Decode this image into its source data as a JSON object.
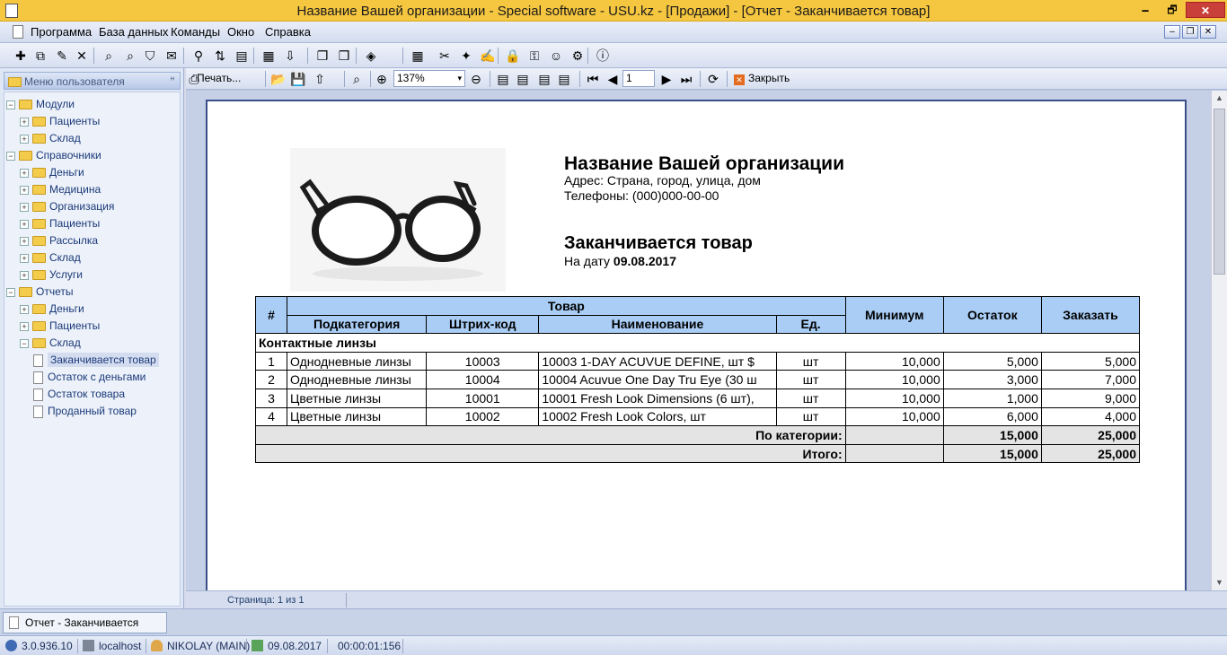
{
  "window": {
    "title": "Название Вашей организации - Special software - USU.kz - [Продажи] - [Отчет - Заканчивается товар]",
    "min_glyph": "🗕",
    "max_glyph": "🗗",
    "close_glyph": "✕"
  },
  "menu": {
    "items": [
      "Программа",
      "База данных",
      "Команды",
      "Окно",
      "Справка"
    ],
    "mdi": [
      "–",
      "❐",
      "✕"
    ]
  },
  "left_panel": {
    "header": "Меню пользователя",
    "pin": "ᵸ",
    "tree": [
      {
        "label": "Модули",
        "level": 0,
        "exp": "−",
        "kind": "folder"
      },
      {
        "label": "Пациенты",
        "level": 1,
        "exp": "+",
        "kind": "folder"
      },
      {
        "label": "Склад",
        "level": 1,
        "exp": "+",
        "kind": "folder"
      },
      {
        "label": "Справочники",
        "level": 0,
        "exp": "−",
        "kind": "folder"
      },
      {
        "label": "Деньги",
        "level": 1,
        "exp": "+",
        "kind": "folder"
      },
      {
        "label": "Медицина",
        "level": 1,
        "exp": "+",
        "kind": "folder"
      },
      {
        "label": "Организация",
        "level": 1,
        "exp": "+",
        "kind": "folder"
      },
      {
        "label": "Пациенты",
        "level": 1,
        "exp": "+",
        "kind": "folder"
      },
      {
        "label": "Рассылка",
        "level": 1,
        "exp": "+",
        "kind": "folder"
      },
      {
        "label": "Склад",
        "level": 1,
        "exp": "+",
        "kind": "folder"
      },
      {
        "label": "Услуги",
        "level": 1,
        "exp": "+",
        "kind": "folder"
      },
      {
        "label": "Отчеты",
        "level": 0,
        "exp": "−",
        "kind": "folder"
      },
      {
        "label": "Деньги",
        "level": 1,
        "exp": "+",
        "kind": "folder"
      },
      {
        "label": "Пациенты",
        "level": 1,
        "exp": "+",
        "kind": "folder"
      },
      {
        "label": "Склад",
        "level": 1,
        "exp": "−",
        "kind": "folder"
      },
      {
        "label": "Заканчивается товар",
        "level": 2,
        "exp": "",
        "kind": "doc",
        "selected": true
      },
      {
        "label": "Остаток с деньгами",
        "level": 2,
        "exp": "",
        "kind": "doc"
      },
      {
        "label": "Остаток товара",
        "level": 2,
        "exp": "",
        "kind": "doc"
      },
      {
        "label": "Проданный товар",
        "level": 2,
        "exp": "",
        "kind": "doc"
      }
    ]
  },
  "report_toolbar": {
    "print_label": "Печать...",
    "zoom": "137%",
    "page": "1",
    "close_label": "Закрыть"
  },
  "report": {
    "org_name": "Название Вашей организации",
    "address": "Адрес: Страна, город, улица, дом",
    "phones": "Телефоны: (000)000-00-00",
    "title": "Заканчивается товар",
    "date_prefix": "На дату",
    "date": "09.08.2017",
    "headers": {
      "num": "#",
      "product": "Товар",
      "subcategory": "Подкатегория",
      "barcode": "Штрих-код",
      "name": "Наименование",
      "unit": "Ед.",
      "minimum": "Минимум",
      "remaining": "Остаток",
      "order": "Заказать"
    },
    "category": "Контактные линзы",
    "rows": [
      {
        "num": "1",
        "subcategory": "Однодневные линзы",
        "barcode": "10003",
        "name": "10003    1-DAY ACUVUE DEFINE, шт $",
        "unit": "шт",
        "minimum": "10,000",
        "remaining": "5,000",
        "order": "5,000"
      },
      {
        "num": "2",
        "subcategory": "Однодневные линзы",
        "barcode": "10004",
        "name": "10004    Acuvue One Day Tru Eye (30 ш",
        "unit": "шт",
        "minimum": "10,000",
        "remaining": "3,000",
        "order": "7,000"
      },
      {
        "num": "3",
        "subcategory": "Цветные линзы",
        "barcode": "10001",
        "name": "10001   Fresh Look Dimensions (6 шт),",
        "unit": "шт",
        "minimum": "10,000",
        "remaining": "1,000",
        "order": "9,000"
      },
      {
        "num": "4",
        "subcategory": "Цветные линзы",
        "barcode": "10002",
        "name": "10002   Fresh Look Colors, шт",
        "unit": "шт",
        "minimum": "10,000",
        "remaining": "6,000",
        "order": "4,000"
      }
    ],
    "category_total": {
      "label": "По категории:",
      "remaining": "15,000",
      "order": "25,000"
    },
    "grand_total": {
      "label": "Итого:",
      "remaining": "15,000",
      "order": "25,000"
    }
  },
  "page_status": "Страница: 1 из 1",
  "tabs": [
    {
      "label": "Отчет - Заканчивается товар"
    }
  ],
  "statusbar": {
    "version": "3.0.936.10",
    "host": "localhost",
    "user": "NIKOLAY (MAIN)",
    "date": "09.08.2017",
    "timer": "00:00:01:156"
  },
  "toolbar_icons": [
    "plus-icon",
    "copy-icon",
    "pencil-icon",
    "delete-icon",
    "search-icon",
    "search-replace-icon",
    "filter-icon",
    "comment-icon",
    "binoculars-icon",
    "sort-icon",
    "group-icon",
    "export-excel-icon",
    "import-icon",
    "new-window-icon",
    "window-edit-icon",
    "speaker-icon",
    "calendar-icon",
    "tools-icon",
    "wand-icon",
    "edit-icon",
    "lock-icon",
    "key-icon",
    "users-icon",
    "settings-icon",
    "info-icon"
  ],
  "toolbar_glyphs": [
    "✚",
    "⧉",
    "✎",
    "✕",
    "⌕",
    "⌕",
    "⛉",
    "✉",
    "⚲",
    "⇅",
    "▤",
    "▦",
    "⇩",
    "❐",
    "❒",
    "◈",
    "▦",
    "✂",
    "✦",
    "✍",
    "🔒",
    "⚿",
    "☺",
    "⚙",
    "ⓘ"
  ],
  "report_glyphs": {
    "print": "⎙",
    "open": "📂",
    "save": "💾",
    "export": "⇧",
    "find": "⌕",
    "zoom_in": "⊕",
    "zoom_out": "⊖",
    "dropdown": "▾",
    "first": "⏮",
    "prev": "◀",
    "next": "▶",
    "last": "⏭",
    "refresh": "⟳",
    "page_setup": "▤",
    "close": "✕"
  },
  "colors": {
    "titlebar": "#f5c640",
    "header_fill": "#a9cdf5",
    "total_fill": "#e4e4e4",
    "tree_text": "#1b3a78"
  }
}
